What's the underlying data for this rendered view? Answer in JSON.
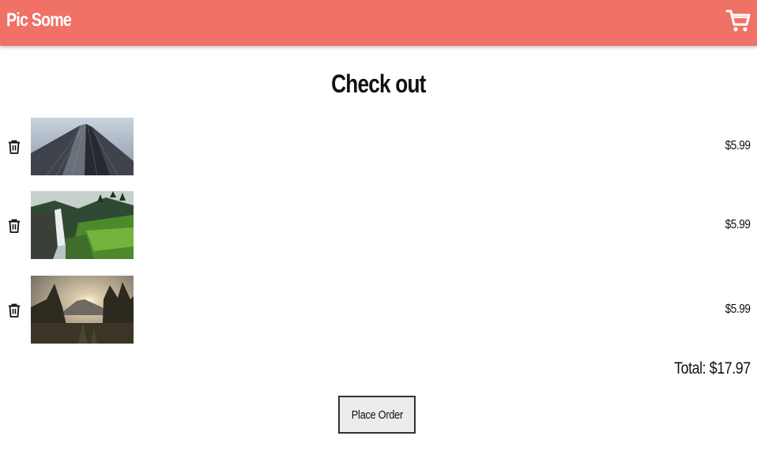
{
  "header": {
    "brand": "Pic Some",
    "cart_icon": "shopping-cart-icon",
    "background": "#f07166"
  },
  "page": {
    "title": "Check out"
  },
  "items": [
    {
      "image": "skyscraper-looking-up",
      "price": "$5.99",
      "delete_icon": "trash-icon"
    },
    {
      "image": "waterfall-forest",
      "price": "$5.99",
      "delete_icon": "trash-icon"
    },
    {
      "image": "mountain-sunset-trees",
      "price": "$5.99",
      "delete_icon": "trash-icon"
    }
  ],
  "total": "Total: $17.97",
  "order_button": {
    "label": "Place Order"
  }
}
